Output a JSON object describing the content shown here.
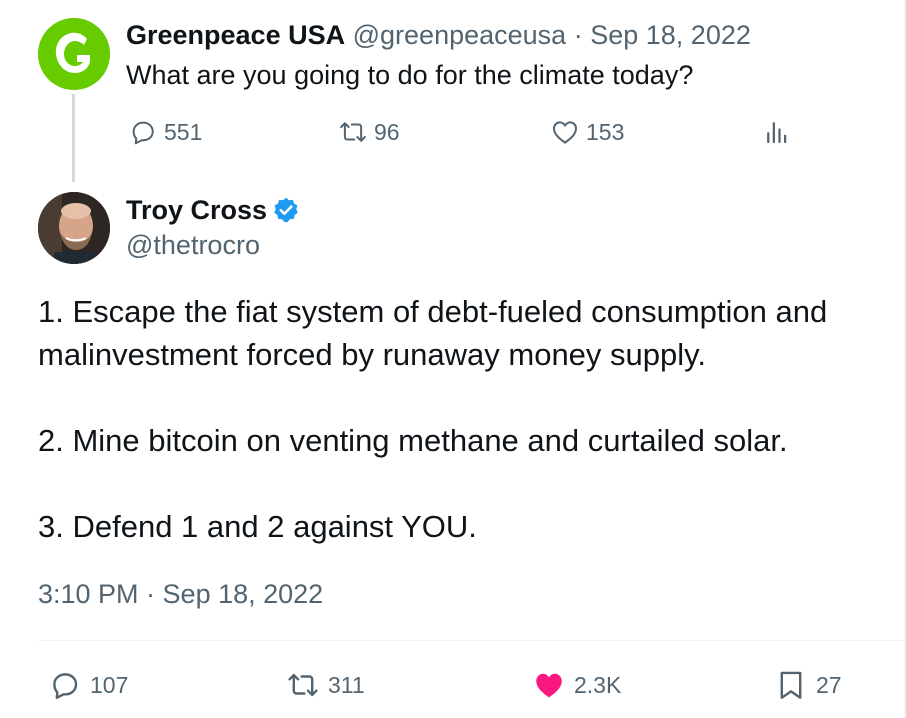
{
  "parent_tweet": {
    "author_name": "Greenpeace USA",
    "author_handle": "@greenpeaceusa",
    "date": "Sep 18, 2022",
    "separator": "·",
    "text": "What are you going to do for the climate today?",
    "replies": "551",
    "retweets": "96",
    "likes": "153",
    "avatar_color": "#66cc00",
    "icons": [
      "reply-icon",
      "retweet-icon",
      "like-icon",
      "views-icon"
    ]
  },
  "main_tweet": {
    "author_name": "Troy Cross",
    "author_handle": "@thetrocro",
    "verified": true,
    "paragraphs": [
      "1. Escape the fiat system of debt-fueled consumption and malinvestment forced by runaway money supply.",
      "2. Mine bitcoin on venting methane and curtailed solar.",
      "3. Defend 1 and 2 against YOU."
    ],
    "timestamp": "3:10 PM · Sep 18, 2022",
    "replies": "107",
    "retweets": "311",
    "likes": "2.3K",
    "bookmarks": "27",
    "liked": true,
    "icons": [
      "reply-icon",
      "retweet-icon",
      "like-icon-filled",
      "bookmark-icon",
      "verified-badge-icon"
    ]
  },
  "colors": {
    "text_primary": "#0f1419",
    "text_secondary": "#536471",
    "like_pink": "#f91880",
    "verified_blue": "#1d9bf0",
    "thread_line": "#cfd9de"
  }
}
